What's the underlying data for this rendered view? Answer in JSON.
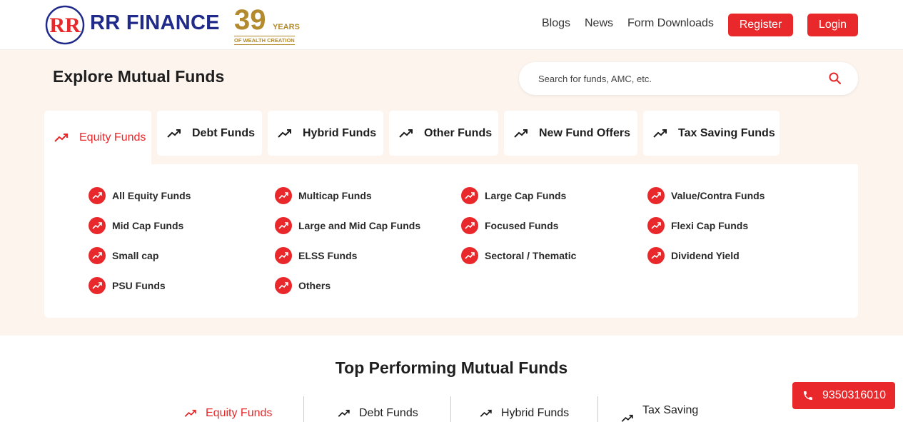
{
  "brand": {
    "name": "RR FINANCE",
    "years_number": "39",
    "years_word": "YEARS",
    "years_tagline": "OF WEALTH CREATION",
    "colors": {
      "primary_red": "#e8282b",
      "brand_blue": "#1f2a8a",
      "gold": "#b38a2e"
    }
  },
  "nav": {
    "blogs": "Blogs",
    "news": "News",
    "form_downloads": "Form Downloads",
    "register": "Register",
    "login": "Login"
  },
  "explore": {
    "title": "Explore Mutual Funds",
    "search_placeholder": "Search for funds, AMC, etc.",
    "search_icon": "search-icon",
    "tabs": [
      {
        "label": "Equity Funds",
        "active": true
      },
      {
        "label": "Debt Funds",
        "active": false
      },
      {
        "label": "Hybrid Funds",
        "active": false
      },
      {
        "label": "Other Funds",
        "active": false
      },
      {
        "label": "New Fund Offers",
        "active": false
      },
      {
        "label": "Tax Saving Funds",
        "active": false
      }
    ],
    "subcategories": [
      [
        "All Equity Funds",
        "Mid Cap Funds",
        "Small cap",
        "PSU Funds"
      ],
      [
        "Multicap Funds",
        "Large and Mid Cap Funds",
        "ELSS Funds",
        "Others"
      ],
      [
        "Large Cap Funds",
        "Focused Funds",
        "Sectoral / Thematic"
      ],
      [
        "Value/Contra Funds",
        "Flexi Cap Funds",
        "Dividend Yield"
      ]
    ]
  },
  "top_performing": {
    "title": "Top Performing Mutual Funds",
    "tabs": [
      {
        "label": "Equity Funds",
        "active": true
      },
      {
        "label": "Debt Funds",
        "active": false
      },
      {
        "label": "Hybrid Funds",
        "active": false
      },
      {
        "label": "Tax Saving",
        "active": false
      }
    ]
  },
  "contact": {
    "phone": "9350316010"
  }
}
